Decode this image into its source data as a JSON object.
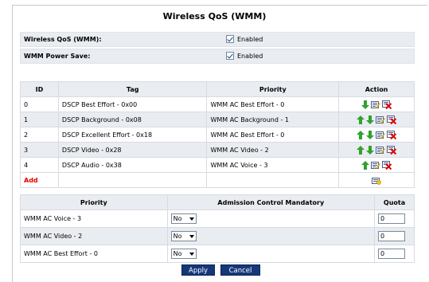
{
  "title": "Wireless QoS (WMM)",
  "settings": [
    {
      "label": "Wireless QoS (WMM):",
      "value": "Enabled"
    },
    {
      "label": "WMM Power Save:",
      "value": "Enabled"
    }
  ],
  "qos_table": {
    "headers": [
      "ID",
      "Tag",
      "Priority",
      "Action"
    ],
    "rows": [
      {
        "id": "0",
        "tag": "DSCP Best Effort - 0x00",
        "priority": "WMM AC Best Effort - 0",
        "actions": [
          "down-arrow-icon",
          "edit-icon",
          "delete-icon"
        ]
      },
      {
        "id": "1",
        "tag": "DSCP Background - 0x08",
        "priority": "WMM AC Background - 1",
        "actions": [
          "up-arrow-icon",
          "down-arrow-icon",
          "edit-icon",
          "delete-icon"
        ]
      },
      {
        "id": "2",
        "tag": "DSCP Excellent Effort - 0x18",
        "priority": "WMM AC Best Effort - 0",
        "actions": [
          "up-arrow-icon",
          "down-arrow-icon",
          "edit-icon",
          "delete-icon"
        ]
      },
      {
        "id": "3",
        "tag": "DSCP Video - 0x28",
        "priority": "WMM AC Video - 2",
        "actions": [
          "up-arrow-icon",
          "down-arrow-icon",
          "edit-icon",
          "delete-icon"
        ]
      },
      {
        "id": "4",
        "tag": "DSCP Audio - 0x38",
        "priority": "WMM AC Voice - 3",
        "actions": [
          "up-arrow-icon",
          "edit-icon",
          "delete-icon"
        ]
      }
    ],
    "add_label": "Add"
  },
  "admission_table": {
    "headers": [
      "Priority",
      "Admission Control Mandatory",
      "Quota"
    ],
    "rows": [
      {
        "priority": "WMM AC Voice - 3",
        "mandatory": "No",
        "quota": "0"
      },
      {
        "priority": "WMM AC Video - 2",
        "mandatory": "No",
        "quota": "0"
      },
      {
        "priority": "WMM AC Best Effort - 0",
        "mandatory": "No",
        "quota": "0"
      }
    ]
  },
  "buttons": {
    "apply": "Apply",
    "cancel": "Cancel"
  },
  "colors": {
    "accent": "#15387a",
    "add": "#e00000",
    "arrow": "#2fa12f",
    "row_alt": "#e9ecf1"
  }
}
